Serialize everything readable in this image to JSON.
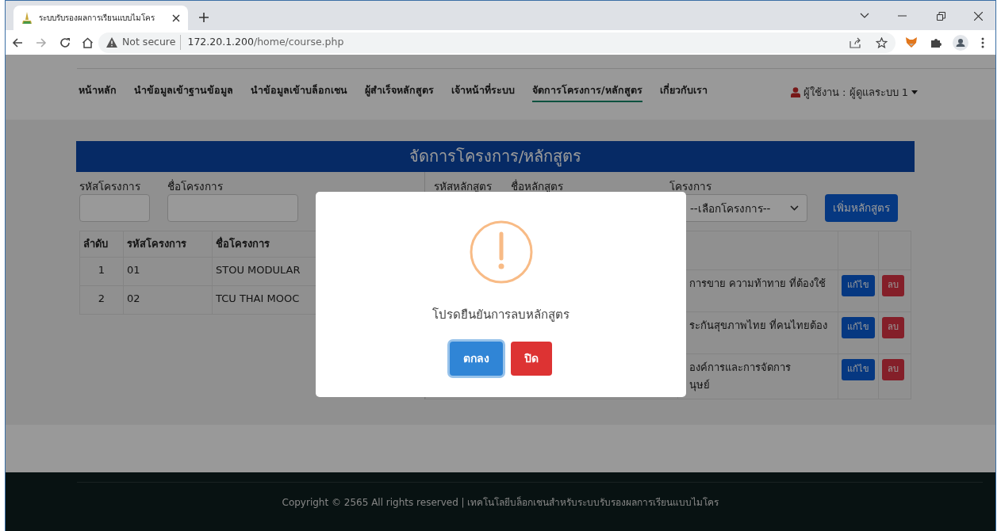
{
  "browser": {
    "tab_title": "ระบบรับรองผลการเรียนแบบไมโคร",
    "security": "Not secure",
    "url_host": "172.20.1.200",
    "url_path": "/home/course.php"
  },
  "nav": {
    "items": [
      {
        "label": "หน้าหลัก",
        "selected": false
      },
      {
        "label": "นำข้อมูลเข้าฐานข้อมูล",
        "selected": false
      },
      {
        "label": "นำข้อมูลเข้าบล็อกเชน",
        "selected": false
      },
      {
        "label": "ผู้สำเร็จหลักสูตร",
        "selected": false
      },
      {
        "label": "เจ้าหน้าที่ระบบ",
        "selected": false
      },
      {
        "label": "จัดการโครงการ/หลักสูตร",
        "selected": true
      },
      {
        "label": "เกี่ยวกับเรา",
        "selected": false
      }
    ],
    "user_label": "ผู้ใช้งาน : ผู้ดูแลระบบ 1"
  },
  "page_title": "จัดการโครงการ/หลักสูตร",
  "project_filters": [
    {
      "label": "รหัสโครงการ"
    },
    {
      "label": "ชื่อโครงการ"
    }
  ],
  "course_filters": {
    "labels": [
      "รหัสหลักสูตร",
      "ชื่อหลักสูตร"
    ],
    "project_label": "โครงการ",
    "project_select": "--เลือกโครงการ--",
    "add_button": "เพิ่มหลักสูตร"
  },
  "project_table": {
    "columns": [
      "ลำดับ",
      "รหัสโครงการ",
      "ชื่อโครงการ"
    ],
    "rows": [
      {
        "no": "1",
        "code": "01",
        "name": "STOU MODULAR"
      },
      {
        "no": "2",
        "code": "02",
        "name": "TCU THAI MOOC"
      }
    ]
  },
  "course_table": {
    "rows": [
      {
        "name_lines": [
          "การขาย ความท้าทาย ที่ต้องใช้"
        ],
        "edit": "แก้ไข",
        "delete": "ลบ"
      },
      {
        "name_lines": [
          "ระกันสุขภาพไทย ที่คนไทยต้อง"
        ],
        "edit": "แก้ไข",
        "delete": "ลบ"
      },
      {
        "name_lines": [
          "องค์การและการจัดการ",
          "นุษย์"
        ],
        "edit": "แก้ไข",
        "delete": "ลบ"
      }
    ]
  },
  "dialog": {
    "message": "โปรดยืนยันการลบหลักสูตร",
    "buttons": [
      {
        "label": "ตกลง",
        "kind": "confirm",
        "focused": true
      },
      {
        "label": "ปิด",
        "kind": "cancel",
        "focused": false
      }
    ]
  },
  "footer": "Copyright © 2565 All rights reserved | เทคโนโลยีบล็อกเชนสำหรับระบบรับรองผลการเรียนแบบไมโคร"
}
